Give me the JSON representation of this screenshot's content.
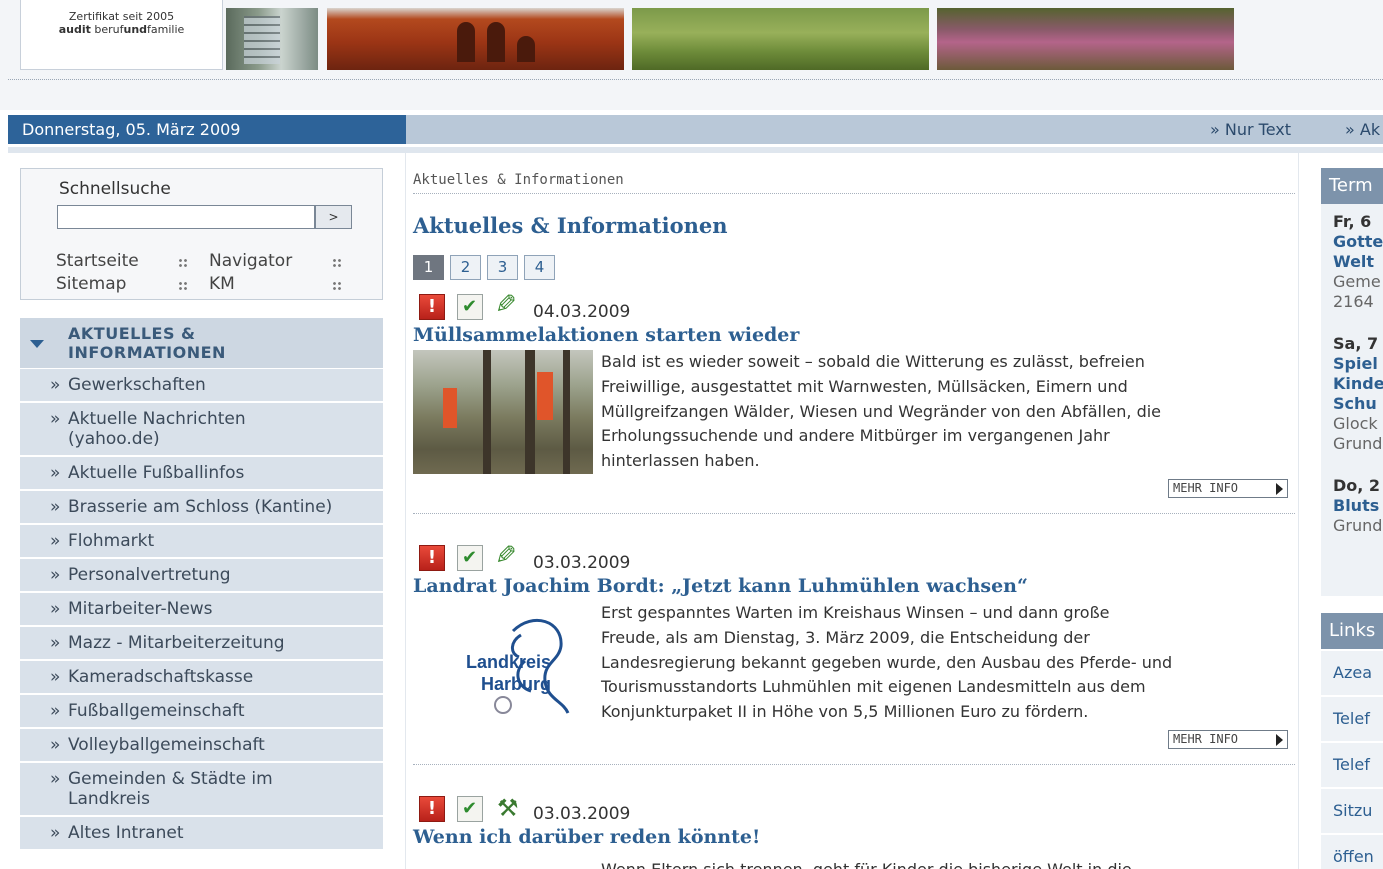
{
  "header": {
    "cert_line1": "Zertifikat seit 2005",
    "cert_line2_bold": "audit",
    "cert_line2_rest_a": " beruf",
    "cert_line2_bold_b": "und",
    "cert_line2_rest_b": "familie"
  },
  "datebar": {
    "date": "Donnerstag, 05. März 2009",
    "link_text_only": "» Nur Text",
    "link_cut": "» Ak"
  },
  "search": {
    "label": "Schnellsuche",
    "value": "",
    "button": ">"
  },
  "quicklinks": [
    "Startseite",
    "Navigator",
    "Sitemap",
    "KM"
  ],
  "nav": {
    "head_line1": "AKTUELLES &",
    "head_line2": "INFORMATIONEN",
    "items": [
      {
        "line1": "Gewerkschaften"
      },
      {
        "line1": "Aktuelle Nachrichten",
        "line2": "(yahoo.de)"
      },
      {
        "line1": "Aktuelle Fußballinfos"
      },
      {
        "line1": "Brasserie am Schloss (Kantine)"
      },
      {
        "line1": "Flohmarkt"
      },
      {
        "line1": "Personalvertretung"
      },
      {
        "line1": "Mitarbeiter-News"
      },
      {
        "line1": "Mazz - Mitarbeiterzeitung"
      },
      {
        "line1": "Kameradschaftskasse"
      },
      {
        "line1": "Fußballgemeinschaft"
      },
      {
        "line1": "Volleyballgemeinschaft"
      },
      {
        "line1": "Gemeinden & Städte im",
        "line2": "Landkreis"
      },
      {
        "line1": "Altes Intranet"
      }
    ]
  },
  "main": {
    "breadcrumb": "Aktuelles & Informationen",
    "title": "Aktuelles & Informationen",
    "pages": [
      "1",
      "2",
      "3",
      "4"
    ],
    "current_page": "1",
    "more_label": "MEHR INFO",
    "articles": [
      {
        "date": "04.03.2009",
        "title": "Müllsammelaktionen starten wieder",
        "lines": [
          "Bald ist es wieder soweit – sobald die Witterung es zulässt, befreien",
          "Freiwillige, ausgestattet mit Warnwesten, Müllsäcken, Eimern und",
          "Müllgreifzangen Wälder, Wiesen und Wegränder von den Abfällen, die",
          "Erholungssuchende und andere Mitbürger im vergangenen Jahr",
          "hinterlassen haben."
        ]
      },
      {
        "date": "03.03.2009",
        "title": "Landrat Joachim Bordt: „Jetzt kann Luhmühlen wachsen“",
        "logo_line1": "Landkreis",
        "logo_line2": "Harburg",
        "lines": [
          "Erst gespanntes Warten im Kreishaus Winsen – und dann große",
          "Freude, als am Dienstag, 3. März 2009, die Entscheidung der",
          "Landesregierung bekannt gegeben wurde, den Ausbau des Pferde- und",
          "Tourismusstandorts Luhmühlen mit eigenen Landesmitteln aus dem",
          "Konjunkturpaket II in Höhe von 5,5 Millionen Euro zu fördern."
        ]
      },
      {
        "date": "03.03.2009",
        "title": "Wenn ich darüber reden könnte!",
        "lines": [
          "Wenn Eltern sich trennen, geht für Kinder die bisherige Welt in die"
        ]
      }
    ]
  },
  "right": {
    "termine_head": "Term",
    "termine": [
      {
        "date": "Fr, 6",
        "title": [
          "Gotte",
          "Welt"
        ],
        "place": [
          "Geme",
          "2164"
        ]
      },
      {
        "date": "Sa, 7",
        "title": [
          "Spiel",
          "Kinde",
          "Schu"
        ],
        "place": [
          "Glock",
          "Grund"
        ]
      },
      {
        "date": "Do, 2",
        "title": [
          "Bluts"
        ],
        "place": [
          "Grund"
        ]
      }
    ],
    "links_head": "Links",
    "links": [
      "Azea",
      "Telef",
      "Telef",
      "Sitzu",
      "öffen"
    ]
  }
}
